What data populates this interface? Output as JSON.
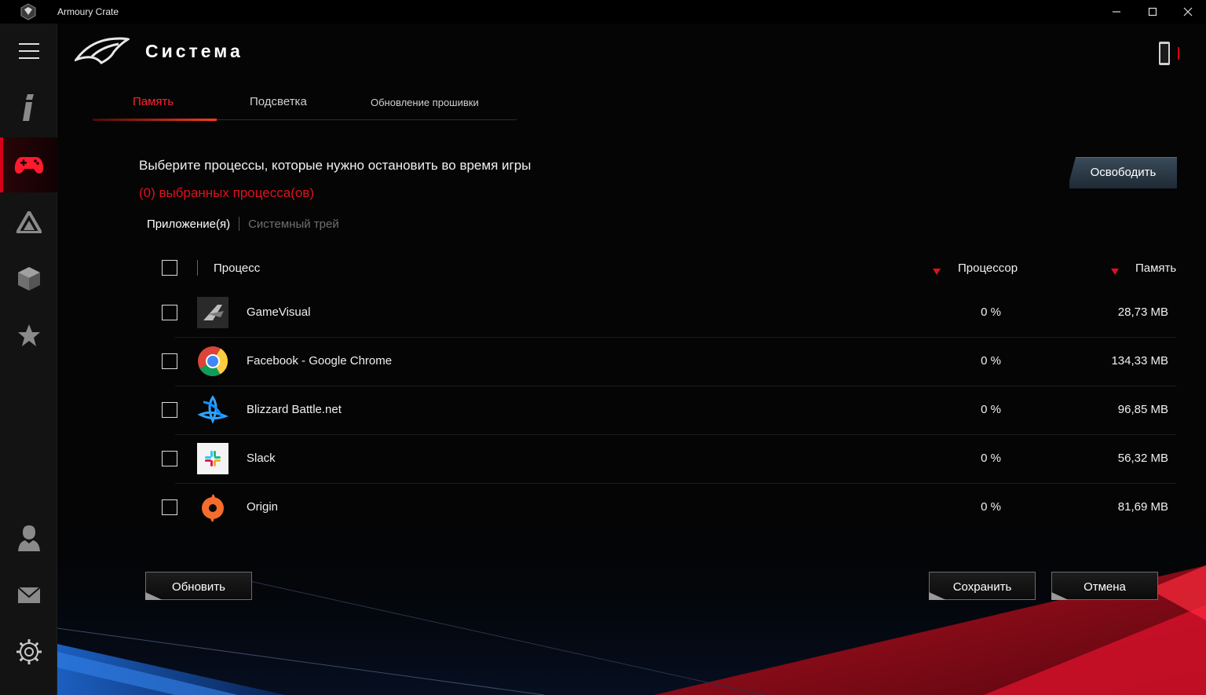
{
  "window": {
    "title": "Armoury Crate",
    "logo_icon": "rog-eye-logo-icon",
    "controls": [
      "minimize-icon",
      "maximize-icon",
      "close-icon"
    ]
  },
  "sidebar": {
    "menu_icon": "hamburger-menu-icon",
    "items": [
      {
        "icon": "info-icon",
        "active": false
      },
      {
        "icon": "gamepad-icon",
        "active": true
      },
      {
        "icon": "aura-triangle-icon",
        "active": false
      },
      {
        "icon": "cube-icon",
        "active": false
      },
      {
        "icon": "star-icon",
        "active": false
      }
    ],
    "bottom_items": [
      "user-icon",
      "mail-icon",
      "settings-gear-icon"
    ]
  },
  "header": {
    "title": "Система",
    "logo": "rog-logo",
    "device_icon": "phone-device-icon"
  },
  "tabs": [
    {
      "label": "Память",
      "active": true
    },
    {
      "label": "Подсветка",
      "active": false
    },
    {
      "label": "Обновление прошивки",
      "active": false
    }
  ],
  "content": {
    "headline": "Выберите процессы, которые нужно остановить во время игры",
    "selected_count": "(0) выбранных процесса(ов)",
    "release_button": "Освободить",
    "subtabs": {
      "apps": "Приложение(я)",
      "tray": "Системный трей"
    }
  },
  "table": {
    "columns": {
      "process": "Процесс",
      "cpu": "Процессор",
      "memory": "Память"
    },
    "rows": [
      {
        "name": "GameVisual",
        "cpu": "0 %",
        "memory": "28,73 MB",
        "icon": "gamevisual-icon",
        "checked": false
      },
      {
        "name": "Facebook - Google Chrome",
        "cpu": "0 %",
        "memory": "134,33 MB",
        "icon": "chrome-icon",
        "checked": false
      },
      {
        "name": "Blizzard Battle.net",
        "cpu": "0 %",
        "memory": "96,85 MB",
        "icon": "battlenet-icon",
        "checked": false
      },
      {
        "name": "Slack",
        "cpu": "0 %",
        "memory": "56,32 MB",
        "icon": "slack-icon",
        "checked": false
      },
      {
        "name": "Origin",
        "cpu": "0 %",
        "memory": "81,69 MB",
        "icon": "origin-icon",
        "checked": false
      }
    ]
  },
  "footer": {
    "refresh": "Обновить",
    "save": "Сохранить",
    "cancel": "Отмена"
  },
  "colors": {
    "accent_red": "#e0101e",
    "background": "#050505",
    "sidebar": "#131313"
  }
}
